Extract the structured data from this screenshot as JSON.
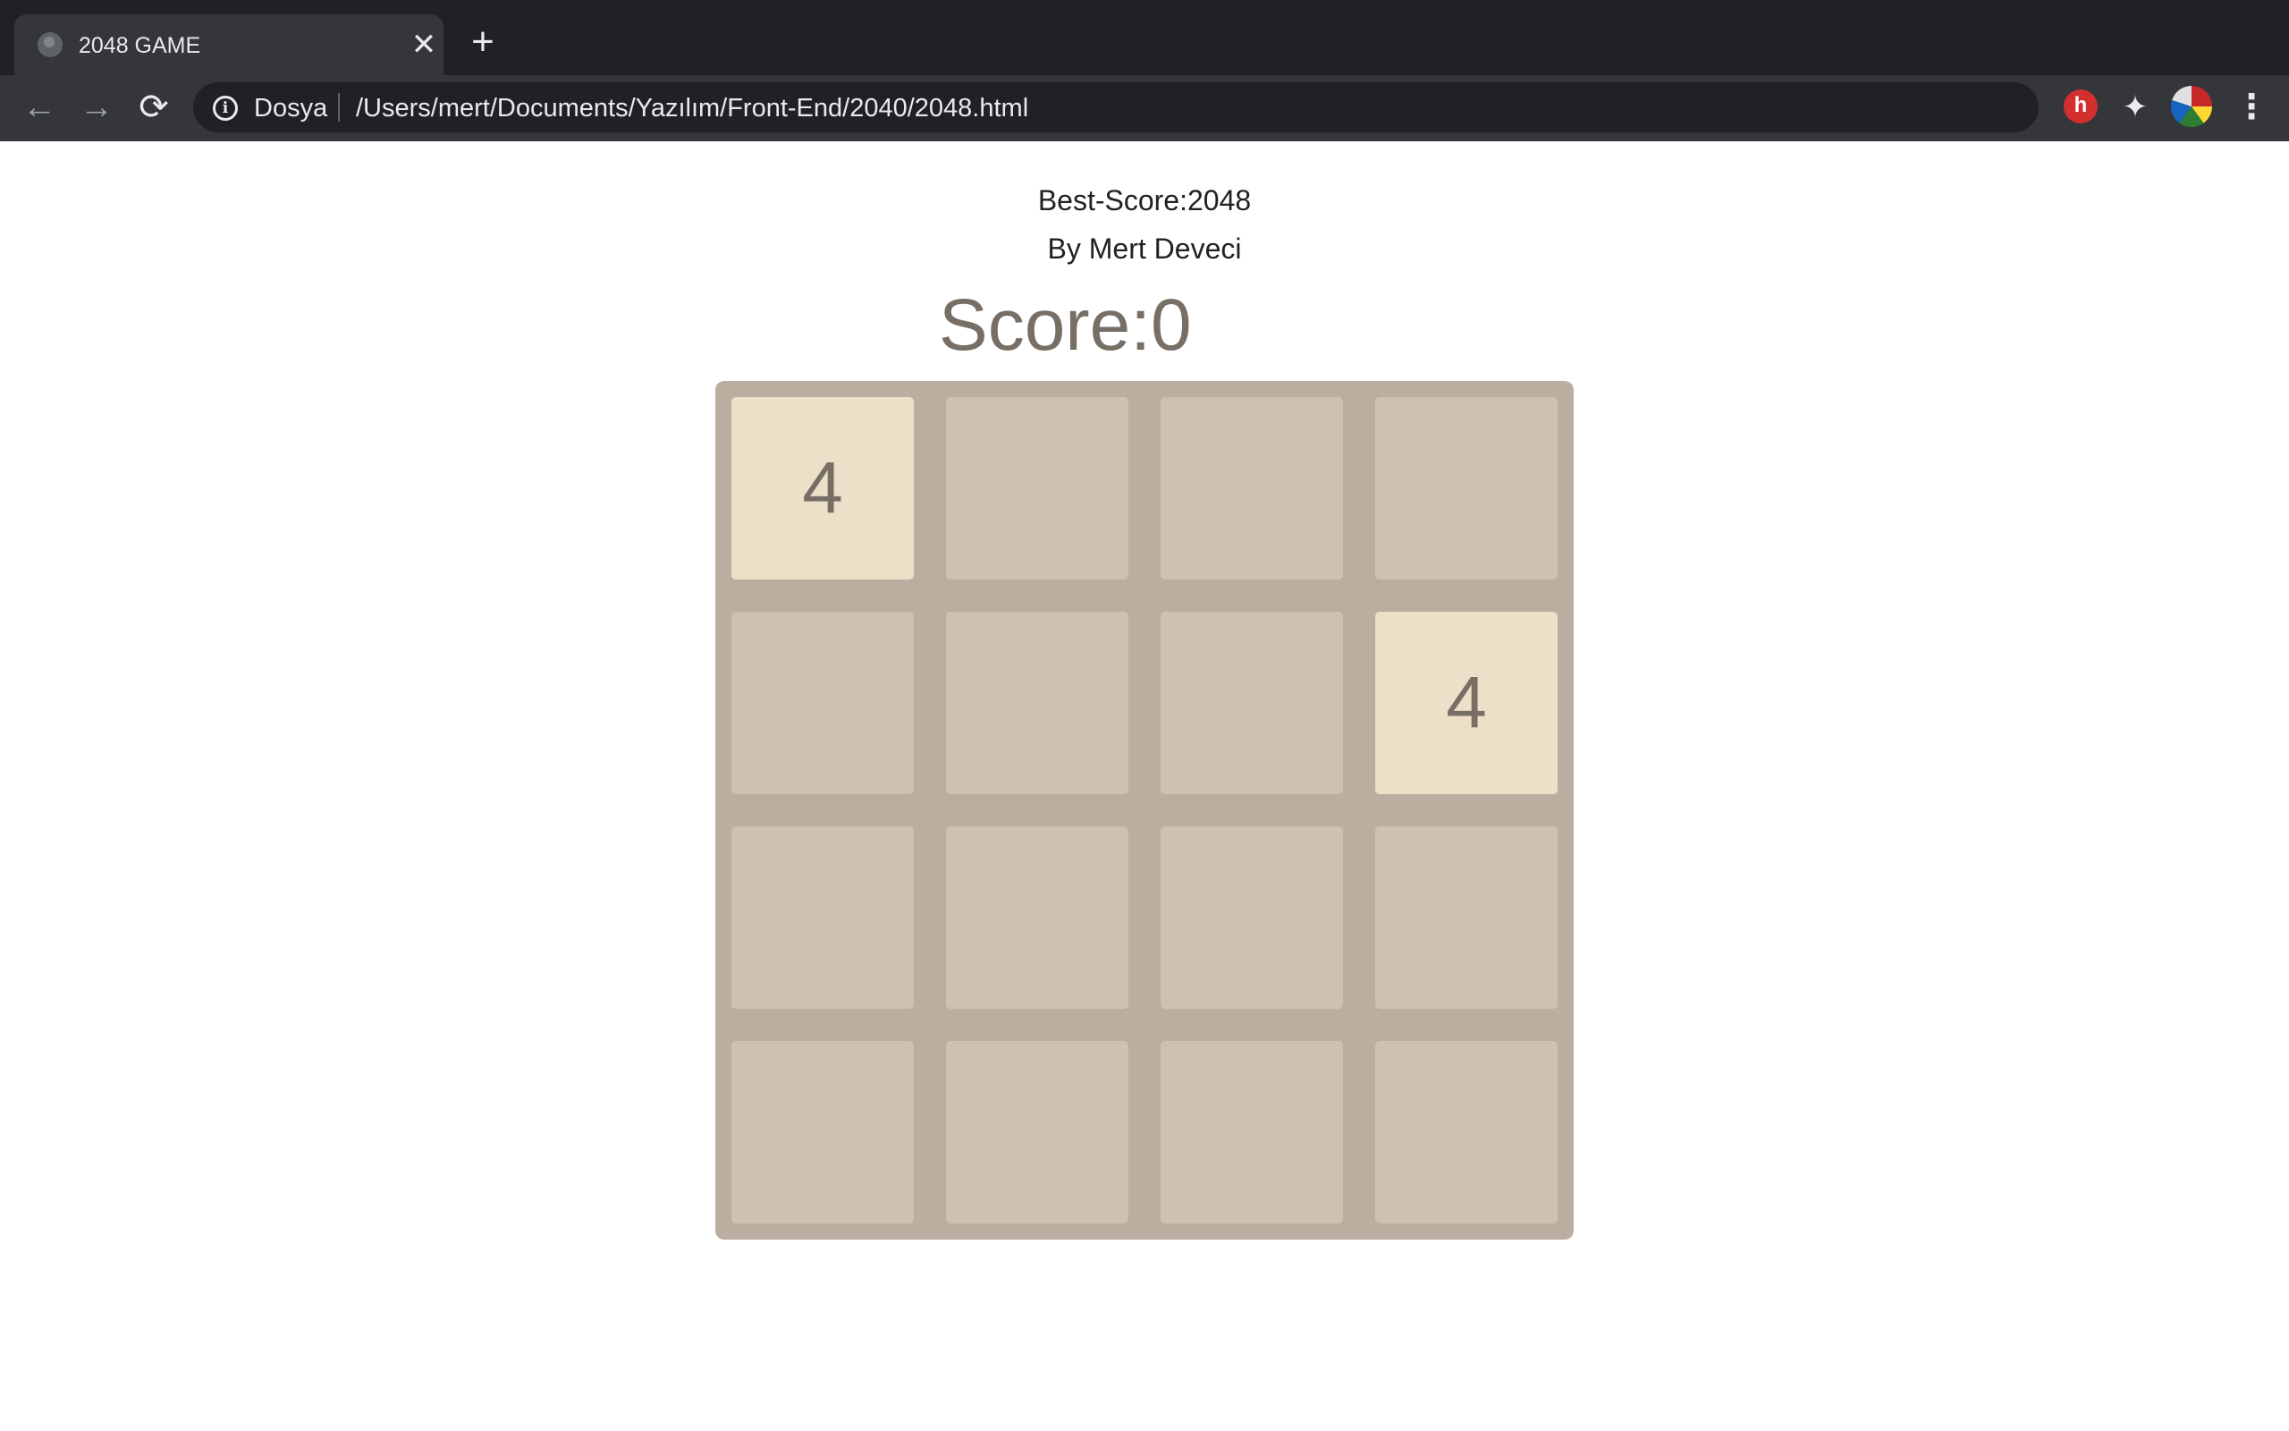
{
  "browser": {
    "tab_title": "2048 GAME",
    "close_glyph": "✕",
    "new_tab_glyph": "+",
    "back_glyph": "←",
    "forward_glyph": "→",
    "reload_glyph": "⟳",
    "info_glyph": "i",
    "url_scheme": "Dosya",
    "url_path": "/Users/mert/Documents/Yazılım/Front-End/2040/2048.html",
    "star_glyph": "☆",
    "puzzle_glyph": "✦",
    "menu_glyph": "⋮",
    "icons": [
      "globe-icon",
      "close-icon",
      "plus-icon",
      "back-arrow-icon",
      "forward-arrow-icon",
      "reload-icon",
      "info-icon",
      "star-icon",
      "extension-icon",
      "puzzle-icon",
      "avatar",
      "kebab-menu-icon"
    ]
  },
  "page": {
    "best_score": "Best-Score:2048",
    "author": "By Mert Deveci",
    "score": "Score:0"
  },
  "board": {
    "colors": {
      "board": "#bbada0",
      "empty_cell": "#cdc1b4",
      "tile_4": "#ede0c8",
      "tile_text": "#776e65"
    },
    "rows": [
      [
        "4",
        "",
        "",
        ""
      ],
      [
        "",
        "",
        "",
        "4"
      ],
      [
        "",
        "",
        "",
        ""
      ],
      [
        "",
        "",
        "",
        ""
      ]
    ]
  }
}
